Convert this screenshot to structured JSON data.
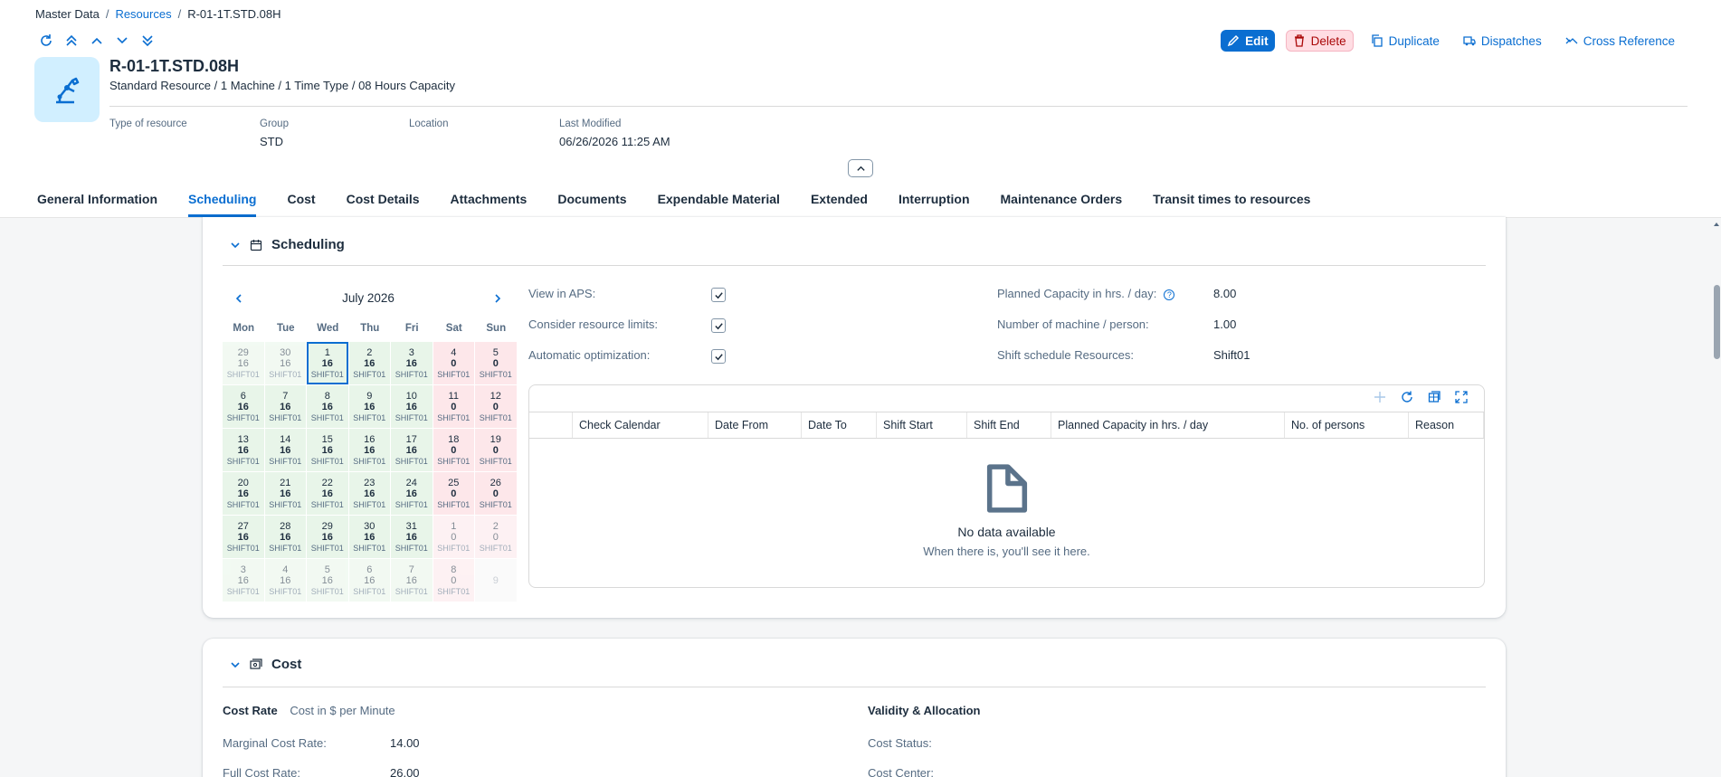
{
  "breadcrumb": {
    "root": "Master Data",
    "parent": "Resources",
    "current": "R-01-1T.STD.08H"
  },
  "actions": {
    "edit": "Edit",
    "delete": "Delete",
    "duplicate": "Duplicate",
    "dispatches": "Dispatches",
    "cross_reference": "Cross Reference"
  },
  "header": {
    "title": "R-01-1T.STD.08H",
    "subtitle": "Standard Resource / 1 Machine / 1 Time Type / 08 Hours Capacity",
    "attributes": [
      {
        "label": "Type of resource",
        "value": ""
      },
      {
        "label": "Group",
        "value": "STD"
      },
      {
        "label": "Location",
        "value": ""
      },
      {
        "label": "Last Modified",
        "value": "06/26/2026 11:25 AM"
      }
    ]
  },
  "tabs": [
    "General Information",
    "Scheduling",
    "Cost",
    "Cost Details",
    "Attachments",
    "Documents",
    "Expendable Material",
    "Extended",
    "Interruption",
    "Maintenance Orders",
    "Transit times to resources"
  ],
  "active_tab": "Scheduling",
  "scheduling": {
    "title": "Scheduling",
    "calendar": {
      "month": "July 2026",
      "weekdays": [
        "Mon",
        "Tue",
        "Wed",
        "Thu",
        "Fri",
        "Sat",
        "Sun"
      ],
      "days": [
        {
          "d": "29",
          "c": "16",
          "s": "SHIFT01",
          "t": "work",
          "o": true
        },
        {
          "d": "30",
          "c": "16",
          "s": "SHIFT01",
          "t": "work",
          "o": true
        },
        {
          "d": "1",
          "c": "16",
          "s": "SHIFT01",
          "t": "work",
          "today": true
        },
        {
          "d": "2",
          "c": "16",
          "s": "SHIFT01",
          "t": "work"
        },
        {
          "d": "3",
          "c": "16",
          "s": "SHIFT01",
          "t": "work"
        },
        {
          "d": "4",
          "c": "0",
          "s": "SHIFT01",
          "t": "off"
        },
        {
          "d": "5",
          "c": "0",
          "s": "SHIFT01",
          "t": "off"
        },
        {
          "d": "6",
          "c": "16",
          "s": "SHIFT01",
          "t": "work"
        },
        {
          "d": "7",
          "c": "16",
          "s": "SHIFT01",
          "t": "work"
        },
        {
          "d": "8",
          "c": "16",
          "s": "SHIFT01",
          "t": "work"
        },
        {
          "d": "9",
          "c": "16",
          "s": "SHIFT01",
          "t": "work"
        },
        {
          "d": "10",
          "c": "16",
          "s": "SHIFT01",
          "t": "work"
        },
        {
          "d": "11",
          "c": "0",
          "s": "SHIFT01",
          "t": "off"
        },
        {
          "d": "12",
          "c": "0",
          "s": "SHIFT01",
          "t": "off"
        },
        {
          "d": "13",
          "c": "16",
          "s": "SHIFT01",
          "t": "work"
        },
        {
          "d": "14",
          "c": "16",
          "s": "SHIFT01",
          "t": "work"
        },
        {
          "d": "15",
          "c": "16",
          "s": "SHIFT01",
          "t": "work"
        },
        {
          "d": "16",
          "c": "16",
          "s": "SHIFT01",
          "t": "work"
        },
        {
          "d": "17",
          "c": "16",
          "s": "SHIFT01",
          "t": "work"
        },
        {
          "d": "18",
          "c": "0",
          "s": "SHIFT01",
          "t": "off"
        },
        {
          "d": "19",
          "c": "0",
          "s": "SHIFT01",
          "t": "off"
        },
        {
          "d": "20",
          "c": "16",
          "s": "SHIFT01",
          "t": "work"
        },
        {
          "d": "21",
          "c": "16",
          "s": "SHIFT01",
          "t": "work"
        },
        {
          "d": "22",
          "c": "16",
          "s": "SHIFT01",
          "t": "work"
        },
        {
          "d": "23",
          "c": "16",
          "s": "SHIFT01",
          "t": "work"
        },
        {
          "d": "24",
          "c": "16",
          "s": "SHIFT01",
          "t": "work"
        },
        {
          "d": "25",
          "c": "0",
          "s": "SHIFT01",
          "t": "off"
        },
        {
          "d": "26",
          "c": "0",
          "s": "SHIFT01",
          "t": "off"
        },
        {
          "d": "27",
          "c": "16",
          "s": "SHIFT01",
          "t": "work"
        },
        {
          "d": "28",
          "c": "16",
          "s": "SHIFT01",
          "t": "work"
        },
        {
          "d": "29",
          "c": "16",
          "s": "SHIFT01",
          "t": "work"
        },
        {
          "d": "30",
          "c": "16",
          "s": "SHIFT01",
          "t": "work"
        },
        {
          "d": "31",
          "c": "16",
          "s": "SHIFT01",
          "t": "work"
        },
        {
          "d": "1",
          "c": "0",
          "s": "SHIFT01",
          "t": "off",
          "o": true
        },
        {
          "d": "2",
          "c": "0",
          "s": "SHIFT01",
          "t": "off",
          "o": true
        },
        {
          "d": "3",
          "c": "16",
          "s": "SHIFT01",
          "t": "work",
          "o": true
        },
        {
          "d": "4",
          "c": "16",
          "s": "SHIFT01",
          "t": "work",
          "o": true
        },
        {
          "d": "5",
          "c": "16",
          "s": "SHIFT01",
          "t": "work",
          "o": true
        },
        {
          "d": "6",
          "c": "16",
          "s": "SHIFT01",
          "t": "work",
          "o": true
        },
        {
          "d": "7",
          "c": "16",
          "s": "SHIFT01",
          "t": "work",
          "o": true
        },
        {
          "d": "8",
          "c": "0",
          "s": "SHIFT01",
          "t": "off",
          "o": true
        },
        {
          "d": "9",
          "c": "",
          "s": "",
          "t": "empty",
          "o": true
        }
      ]
    },
    "fields": {
      "view_in_aps": "View in APS:",
      "consider_limits": "Consider resource limits:",
      "auto_optimization": "Automatic optimization:",
      "planned_capacity_label": "Planned Capacity in hrs. / day:",
      "planned_capacity_value": "8.00",
      "machines_label": "Number of machine / person:",
      "machines_value": "1.00",
      "shift_label": "Shift schedule Resources:",
      "shift_value": "Shift01"
    },
    "table": {
      "columns": [
        "",
        "Check Calendar",
        "Date From",
        "Date To",
        "Shift Start",
        "Shift End",
        "Planned Capacity in hrs. / day",
        "No. of persons",
        "Reason"
      ],
      "no_data": "No data available",
      "no_data_hint": "When there is, you'll see it here."
    }
  },
  "cost": {
    "title": "Cost",
    "rate_label": "Cost Rate",
    "rate_unit": "Cost in $ per Minute",
    "marginal_label": "Marginal Cost Rate:",
    "marginal_value": "14.00",
    "full_label": "Full Cost Rate:",
    "full_value": "26.00",
    "validity_label": "Validity & Allocation",
    "status_label": "Cost Status:",
    "center_label": "Cost Center:"
  }
}
